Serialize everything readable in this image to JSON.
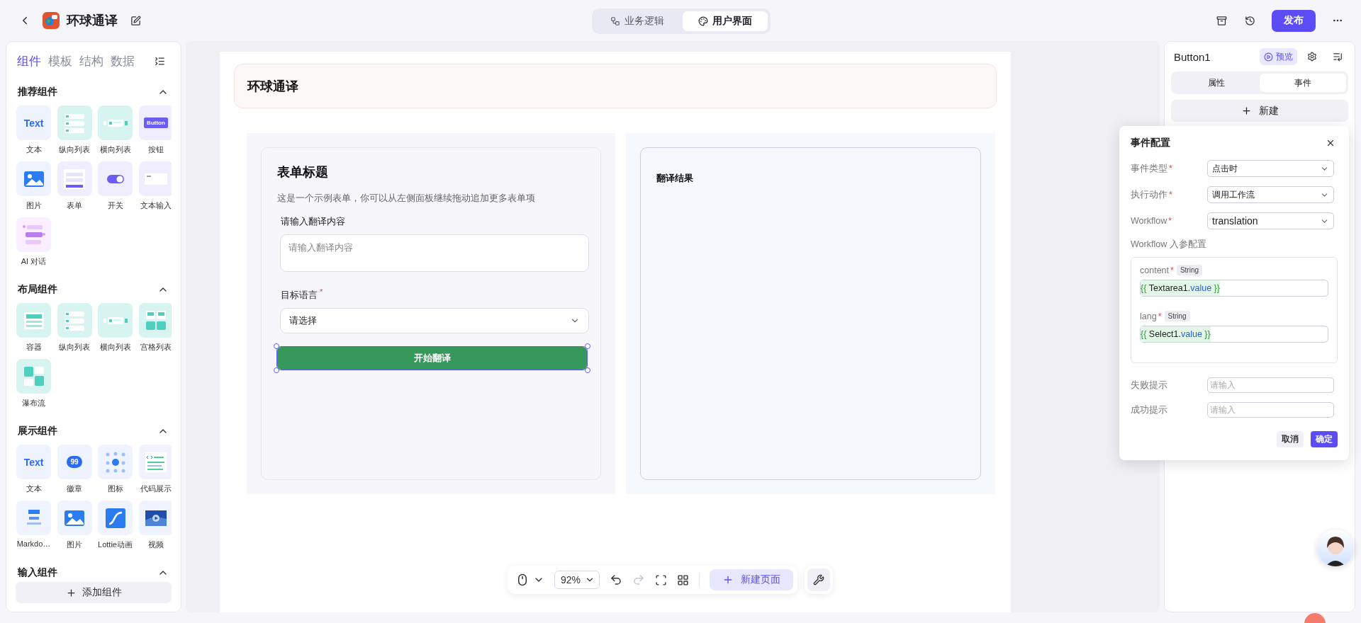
{
  "app": {
    "title": "环球通译"
  },
  "mode_tabs": [
    {
      "label": "业务逻辑",
      "selected": false
    },
    {
      "label": "用户界面",
      "selected": true
    }
  ],
  "publish_button": "发布",
  "left_panel": {
    "tabs": [
      {
        "label": "组件",
        "selected": true
      },
      {
        "label": "模板",
        "selected": false
      },
      {
        "label": "结构",
        "selected": false
      },
      {
        "label": "数据",
        "selected": false
      }
    ],
    "sections": [
      {
        "title": "推荐组件",
        "expanded": true,
        "items": [
          {
            "label": "文本",
            "kind": "text",
            "preview": "Text"
          },
          {
            "label": "纵向列表",
            "kind": "vlist"
          },
          {
            "label": "横向列表",
            "kind": "hlist"
          },
          {
            "label": "按钮",
            "kind": "button",
            "preview": "Button"
          },
          {
            "label": "图片",
            "kind": "image"
          },
          {
            "label": "表单",
            "kind": "form"
          },
          {
            "label": "开关",
            "kind": "switch"
          },
          {
            "label": "文本输入",
            "kind": "input"
          },
          {
            "label": "AI 对话",
            "kind": "chat"
          }
        ]
      },
      {
        "title": "布局组件",
        "expanded": true,
        "items": [
          {
            "label": "容器",
            "kind": "container"
          },
          {
            "label": "纵向列表",
            "kind": "vlist"
          },
          {
            "label": "横向列表",
            "kind": "hlist"
          },
          {
            "label": "宫格列表",
            "kind": "grid"
          },
          {
            "label": "瀑布流",
            "kind": "waterfall"
          }
        ]
      },
      {
        "title": "展示组件",
        "expanded": true,
        "items": [
          {
            "label": "文本",
            "kind": "text",
            "preview": "Text"
          },
          {
            "label": "徽章",
            "kind": "badge",
            "preview": "99"
          },
          {
            "label": "图标",
            "kind": "icons"
          },
          {
            "label": "代码展示",
            "kind": "code"
          },
          {
            "label": "Markdo…",
            "kind": "markdown"
          },
          {
            "label": "图片",
            "kind": "image"
          },
          {
            "label": "Lottie动画",
            "kind": "lottie"
          },
          {
            "label": "视频",
            "kind": "video"
          }
        ]
      },
      {
        "title": "输入组件",
        "expanded": true
      }
    ],
    "add_button": "添加组件"
  },
  "canvas": {
    "header_title": "环球通译",
    "form": {
      "title": "表单标题",
      "description": "这是一个示例表单，你可以从左侧面板继续拖动追加更多表单项",
      "fields": [
        {
          "kind": "textarea",
          "label": "请输入翻译内容",
          "placeholder": "请输入翻译内容"
        },
        {
          "kind": "select",
          "label": "目标语言",
          "mark": "*",
          "value": "请选择"
        }
      ],
      "submit": {
        "label": "开始翻译",
        "selected": true
      }
    },
    "result": {
      "title": "翻译结果"
    }
  },
  "toolbar": {
    "zoom": "92%",
    "redo_disabled": true,
    "new_page": "新建页面"
  },
  "inspector": {
    "component": "Button1",
    "preview": "预览",
    "tabs": [
      {
        "label": "属性",
        "selected": false
      },
      {
        "label": "事件",
        "selected": true
      }
    ],
    "new_button": "新建"
  },
  "event_dialog": {
    "title": "事件配置",
    "selects": [
      {
        "label": "事件类型",
        "mark": "*",
        "value": "点击时"
      },
      {
        "label": "执行动作",
        "mark": "*",
        "value": "调用工作流"
      },
      {
        "label": "Workflow",
        "mark": "*",
        "value": "translation"
      }
    ],
    "params_title": "Workflow 入参配置",
    "params": [
      {
        "name": "content",
        "mark": "*",
        "type": "String",
        "tokens": [
          {
            "text": "{{ ",
            "kind": "brace"
          },
          {
            "text": "Textarea1.",
            "kind": "ref"
          },
          {
            "text": "value",
            "kind": "prop"
          },
          {
            "text": " }}",
            "kind": "brace"
          }
        ]
      },
      {
        "name": "lang",
        "mark": "*",
        "type": "String",
        "tokens": [
          {
            "text": "{{ ",
            "kind": "brace"
          },
          {
            "text": "Select1.",
            "kind": "ref"
          },
          {
            "text": "value",
            "kind": "prop"
          },
          {
            "text": " }}",
            "kind": "brace"
          }
        ]
      }
    ],
    "inputs": [
      {
        "label": "失败提示",
        "placeholder": "请输入"
      },
      {
        "label": "成功提示",
        "placeholder": "请输入"
      }
    ],
    "cancel": "取消",
    "confirm": "确定"
  }
}
